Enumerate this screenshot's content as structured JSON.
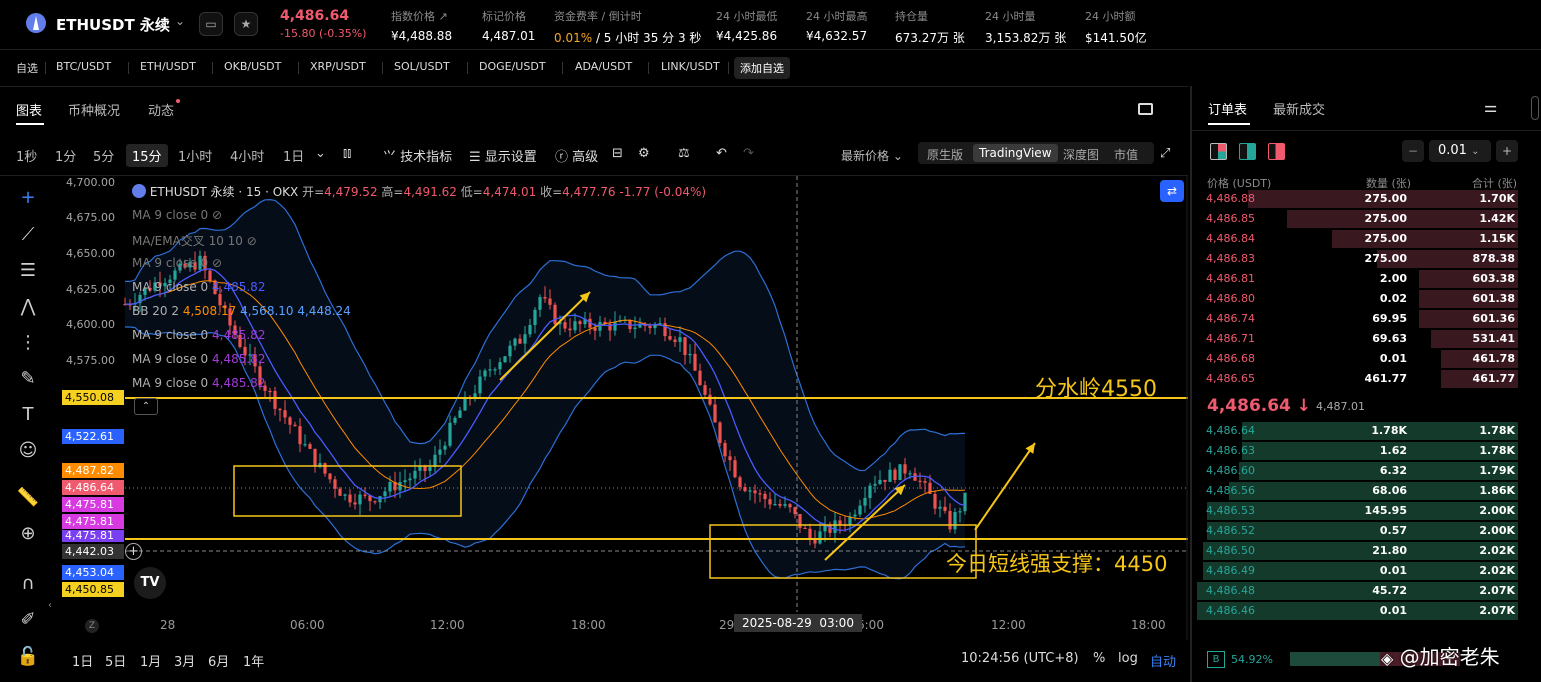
{
  "header": {
    "symbol": "ETHUSDT 永续",
    "last_price": "4,486.64",
    "change": "-15.80 (-0.35%)",
    "stats": [
      {
        "label": "指数价格 ↗",
        "value": "¥4,488.88"
      },
      {
        "label": "标记价格",
        "value": "4,487.01"
      },
      {
        "label": "资金费率 / 倒计时",
        "value_rate": "0.01%",
        "value": " / 5 小时 35 分 3 秒"
      },
      {
        "label": "24 小时最低",
        "value": "¥4,425.86"
      },
      {
        "label": "24 小时最高",
        "value": "¥4,632.57"
      },
      {
        "label": "持仓量",
        "value": "673.27万 张"
      },
      {
        "label": "24 小时量",
        "value": "3,153.82万 张"
      },
      {
        "label": "24 小时额",
        "value": "$141.50亿"
      }
    ]
  },
  "favorites": {
    "title": "自选",
    "items": [
      "BTC/USDT",
      "ETH/USDT",
      "OKB/USDT",
      "XRP/USDT",
      "SOL/USDT",
      "DOGE/USDT",
      "ADA/USDT",
      "LINK/USDT"
    ],
    "add_label": "添加自选"
  },
  "main_tabs": [
    "图表",
    "币种概况",
    "动态"
  ],
  "intervals": [
    "1秒",
    "1分",
    "5分",
    "15分",
    "1小时",
    "4小时",
    "1日"
  ],
  "toolbar": {
    "indicators": "技术指标",
    "display": "显示设置",
    "advanced": "高级",
    "latest_price": "最新价格",
    "views": [
      "原生版",
      "TradingView",
      "深度图",
      "市值"
    ]
  },
  "chart": {
    "legend_main": "ETHUSDT 永续 · 15 · OKX",
    "ohlc": {
      "open_label": "开=",
      "open": "4,479.52",
      "high_label": "高=",
      "high": "4,491.62",
      "low_label": "低=",
      "low": "4,474.01",
      "close_label": "收=",
      "close": "4,477.76",
      "chg": "-1.77 (-0.04%)"
    },
    "indicators": [
      {
        "name": "MA 9 close 0",
        "value": ""
      },
      {
        "name": "MA/EMA交叉 10 10",
        "value": ""
      },
      {
        "name": "MA 9 close 0",
        "value": ""
      },
      {
        "name": "MA 9 close 0",
        "value": "4,485.82"
      },
      {
        "name": "BB 20 2",
        "value": "4,508.17",
        "value2": "4,568.10",
        "value3": "4,448.24"
      },
      {
        "name": "MA 9 close 0",
        "value": "4,485.82"
      },
      {
        "name": "MA 9 close 0",
        "value": "4,485.82"
      },
      {
        "name": "MA 9 close 0",
        "value": "4,485.82"
      }
    ],
    "price_axis": [
      "4,700.00",
      "4,675.00",
      "4,650.00",
      "4,625.00",
      "4,600.00",
      "4,575.00"
    ],
    "price_tags": [
      {
        "value": "4,550.08",
        "color": "#f5d020"
      },
      {
        "value": "4,522.61",
        "color": "#2962ff"
      },
      {
        "value": "4,487.82",
        "color": "#ff8c00"
      },
      {
        "value": "4,486.64",
        "color": "#f05a6e"
      },
      {
        "value": "4,475.81",
        "color": "#d63ae0"
      },
      {
        "value": "4,475.81",
        "color": "#d63ae0"
      },
      {
        "value": "4,475.81",
        "color": "#7b3ff2"
      },
      {
        "value": "4,442.03",
        "color": "#333"
      },
      {
        "value": "4,453.04",
        "color": "#2962ff"
      },
      {
        "value": "4,450.85",
        "color": "#f5d020"
      }
    ],
    "x_axis": [
      "28",
      "06:00",
      "12:00",
      "18:00",
      "29",
      "6:00",
      "12:00",
      "18:00"
    ],
    "crosshair_label": "2025-08-29  03:00",
    "annotation_watershed": "分水岭4550",
    "annotation_support": "今日短线强支撑：4450",
    "time": "10:24:56 (UTC+8)",
    "ranges": [
      "1日",
      "5日",
      "1月",
      "3月",
      "6月",
      "1年"
    ],
    "scale_buttons": [
      "%",
      "log",
      "自动"
    ],
    "series_colors": {
      "up": "#26a69a",
      "down": "#ef5350",
      "bb": "#2c6fd6",
      "ma_orange": "#ff8c00",
      "ma_blue": "#4a5bff",
      "annotation": "#f5c518"
    }
  },
  "orderbook": {
    "tabs": [
      "订单表",
      "最新成交"
    ],
    "tick": "0.01",
    "headers": [
      "价格 (USDT)",
      "数量 (张)",
      "合计 (张)"
    ],
    "asks": [
      {
        "price": "4,486.88",
        "qty": "275.00",
        "total": "1.70K"
      },
      {
        "price": "4,486.85",
        "qty": "275.00",
        "total": "1.42K"
      },
      {
        "price": "4,486.84",
        "qty": "275.00",
        "total": "1.15K"
      },
      {
        "price": "4,486.83",
        "qty": "275.00",
        "total": "878.38"
      },
      {
        "price": "4,486.81",
        "qty": "2.00",
        "total": "603.38"
      },
      {
        "price": "4,486.80",
        "qty": "0.02",
        "total": "601.38"
      },
      {
        "price": "4,486.74",
        "qty": "69.95",
        "total": "601.36"
      },
      {
        "price": "4,486.71",
        "qty": "69.63",
        "total": "531.41"
      },
      {
        "price": "4,486.68",
        "qty": "0.01",
        "total": "461.78"
      },
      {
        "price": "4,486.65",
        "qty": "461.77",
        "total": "461.77"
      }
    ],
    "mid_price": "4,486.64 ↓",
    "mid_mark": "4,487.01",
    "bids": [
      {
        "price": "4,486.64",
        "qty": "1.78K",
        "total": "1.78K"
      },
      {
        "price": "4,486.63",
        "qty": "1.62",
        "total": "1.78K"
      },
      {
        "price": "4,486.60",
        "qty": "6.32",
        "total": "1.79K"
      },
      {
        "price": "4,486.56",
        "qty": "68.06",
        "total": "1.86K"
      },
      {
        "price": "4,486.53",
        "qty": "145.95",
        "total": "2.00K"
      },
      {
        "price": "4,486.52",
        "qty": "0.57",
        "total": "2.00K"
      },
      {
        "price": "4,486.50",
        "qty": "21.80",
        "total": "2.02K"
      },
      {
        "price": "4,486.49",
        "qty": "0.01",
        "total": "2.02K"
      },
      {
        "price": "4,486.48",
        "qty": "45.72",
        "total": "2.07K"
      },
      {
        "price": "4,486.46",
        "qty": "0.01",
        "total": "2.07K"
      }
    ],
    "buy_ratio": "54.92%",
    "watermark": "@加密老朱"
  }
}
